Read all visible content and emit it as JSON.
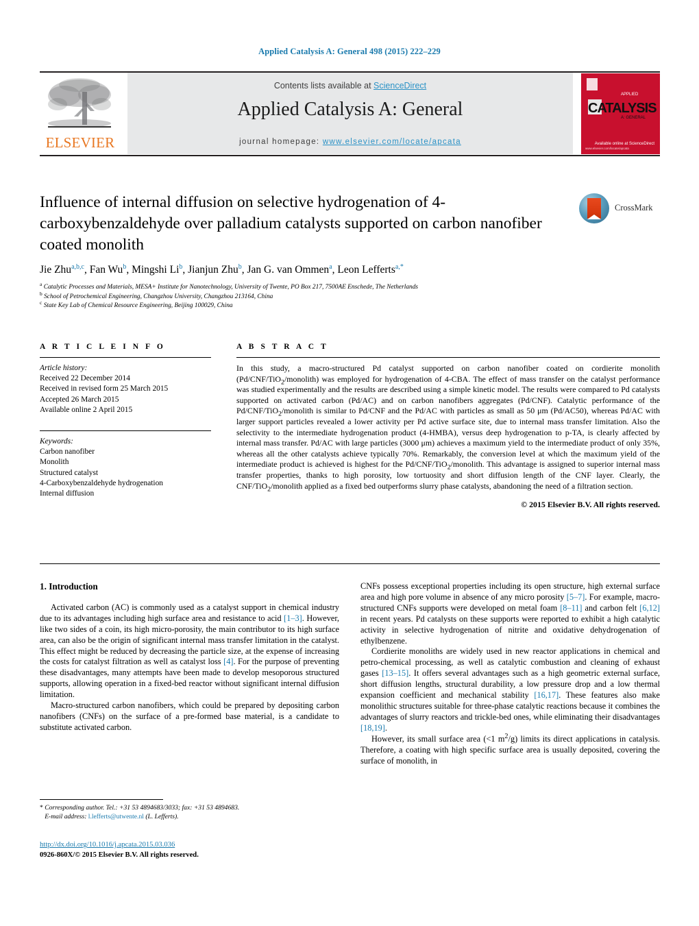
{
  "running_head": "Applied Catalysis A: General 498 (2015) 222–229",
  "masthead": {
    "publisher_logo_name": "elsevier-tree-logo",
    "publisher_wordmark": "ELSEVIER",
    "contents_prefix": "Contents lists available at ",
    "contents_link": "ScienceDirect",
    "journal_title": "Applied Catalysis A: General",
    "homepage_prefix": "journal homepage: ",
    "homepage_url": "www.elsevier.com/locate/apcata",
    "cover": {
      "brand": "CATALYSIS",
      "small_top": "APPLIED",
      "small_bottom": "A: GENERAL",
      "sciencedirect": "Available online at\nScienceDirect",
      "footer_url": "www.elsevier.com/locate/apcata"
    }
  },
  "article": {
    "title": "Influence of internal diffusion on selective hydrogenation of 4-carboxybenzaldehyde over palladium catalysts supported on carbon nanofiber coated monolith",
    "crossmark_label": "CrossMark",
    "authors_html": "Jie Zhu<sup>a,b,c</sup>, Fan Wu<sup>b</sup>, Mingshi Li<sup>b</sup>, Jianjun Zhu<sup>b</sup>, Jan G. van Ommen<sup>a</sup>, Leon Lefferts<sup>a,<span class=\"star\">*</span></sup>",
    "affiliations": [
      "a Catalytic Processes and Materials, MESA+ Institute for Nanotechnology, University of Twente, PO Box 217, 7500AE Enschede, The Netherlands",
      "b School of Petrochemical Engineering, Changzhou University, Changzhou 213164, China",
      "c State Key Lab of Chemical Resource Engineering, Beijing 100029, China"
    ],
    "affiliation_marks": [
      "a",
      "b",
      "c"
    ],
    "affiliation_texts": [
      "Catalytic Processes and Materials, MESA+ Institute for Nanotechnology, University of Twente, PO Box 217, 7500AE Enschede, The Netherlands",
      "School of Petrochemical Engineering, Changzhou University, Changzhou 213164, China",
      "State Key Lab of Chemical Resource Engineering, Beijing 100029, China"
    ]
  },
  "article_info": {
    "heading": "A R T I C L E   I N F O",
    "history_label": "Article history:",
    "history": [
      "Received 22 December 2014",
      "Received in revised form 25 March 2015",
      "Accepted 26 March 2015",
      "Available online 2 April 2015"
    ],
    "keywords_label": "Keywords:",
    "keywords": [
      "Carbon nanofiber",
      "Monolith",
      "Structured catalyst",
      "4-Carboxybenzaldehyde hydrogenation",
      "Internal diffusion"
    ]
  },
  "abstract": {
    "heading": "A B S T R A C T",
    "text_html": "In this study, a macro-structured Pd catalyst supported on carbon nanofiber coated on cordierite monolith (Pd/CNF/TiO<sub>2</sub>/monolith) was employed for hydrogenation of 4-CBA. The effect of mass transfer on the catalyst performance was studied experimentally and the results are described using a simple kinetic model. The results were compared to Pd catalysts supported on activated carbon (Pd/AC) and on carbon nanofibers aggregates (Pd/CNF). Catalytic performance of the Pd/CNF/TiO<sub>2</sub>/monolith is similar to Pd/CNF and the Pd/AC with particles as small as 50 &#956;m (Pd/AC50), whereas Pd/AC with larger support particles revealed a lower activity per Pd active surface site, due to internal mass transfer limitation. Also the selectivity to the intermediate hydrogenation product (4-HMBA), versus deep hydrogenation to p-TA, is clearly affected by internal mass transfer. Pd/AC with large particles (3000 &#956;m) achieves a maximum yield to the intermediate product of only 35%, whereas all the other catalysts achieve typically 70%. Remarkably, the conversion level at which the maximum yield of the intermediate product is achieved is highest for the Pd/CNF/TiO<sub>2</sub>/monolith. This advantage is assigned to superior internal mass transfer properties, thanks to high porosity, low tortuosity and short diffusion length of the CNF layer. Clearly, the CNF/TiO<sub>2</sub>/monolith applied as a fixed bed outperforms slurry phase catalysts, abandoning the need of a filtration section.",
    "copyright": "© 2015 Elsevier B.V. All rights reserved."
  },
  "introduction": {
    "heading": "1.  Introduction",
    "left_paragraphs_html": [
      "Activated carbon (AC) is commonly used as a catalyst support in chemical industry due to its advantages including high surface area and resistance to acid <span class=\"ref\">[1–3]</span>. However, like two sides of a coin, its high micro-porosity, the main contributor to its high surface area, can also be the origin of significant internal mass transfer limitation in the catalyst. This effect might be reduced by decreasing the particle size, at the expense of increasing the costs for catalyst filtration as well as catalyst loss <span class=\"ref\">[4]</span>. For the purpose of preventing these disadvantages, many attempts have been made to develop mesoporous structured supports, allowing operation in a fixed-bed reactor without significant internal diffusion limitation.",
      "Macro-structured carbon nanofibers, which could be prepared by depositing carbon nanofibers (CNFs) on the surface of a pre-formed base material, is a candidate to substitute activated carbon."
    ],
    "right_paragraphs_html": [
      "CNFs possess exceptional properties including its open structure, high external surface area and high pore volume in absence of any micro porosity <span class=\"ref\">[5–7]</span>. For example, macro-structured CNFs supports were developed on metal foam <span class=\"ref\">[8–11]</span> and carbon felt <span class=\"ref\">[6,12]</span> in recent years. Pd catalysts on these supports were reported to exhibit a high catalytic activity in selective hydrogenation of nitrite and oxidative dehydrogenation of ethylbenzene.",
      "Cordierite monoliths are widely used in new reactor applications in chemical and petro-chemical processing, as well as catalytic combustion and cleaning of exhaust gases <span class=\"ref\">[13–15]</span>. It offers several advantages such as a high geometric external surface, short diffusion lengths, structural durability, a low pressure drop and a low thermal expansion coefficient and mechanical stability <span class=\"ref\">[16,17]</span>. These features also make monolithic structures suitable for three-phase catalytic reactions because it combines the advantages of slurry reactors and trickle-bed ones, while eliminating their disadvantages <span class=\"ref\">[18,19]</span>.",
      "However, its small surface area (&lt;1 m<sup>2</sup>/g) limits its direct applications in catalysis. Therefore, a coating with high specific surface area is usually deposited, covering the surface of monolith, in"
    ]
  },
  "footnote_html": "<span class=\"star\">*</span>  Corresponding author. Tel.: +31 53 4894683/3033; fax: +31 53 4894683.<br>&nbsp;&nbsp;&nbsp;E-mail address: <span class=\"mail\">l.lefferts@utwente.nl</span> (L. Lefferts).",
  "footer": {
    "doi": "http://dx.doi.org/10.1016/j.apcata.2015.03.036",
    "issn_line": "0926-860X/© 2015 Elsevier B.V. All rights reserved."
  },
  "colors": {
    "link_blue": "#1a7aad",
    "sciencedirect_blue": "#2b92c6",
    "elsevier_orange": "#E87722",
    "cover_red": "#c8102e",
    "banner_gray": "#e7e8e9"
  }
}
